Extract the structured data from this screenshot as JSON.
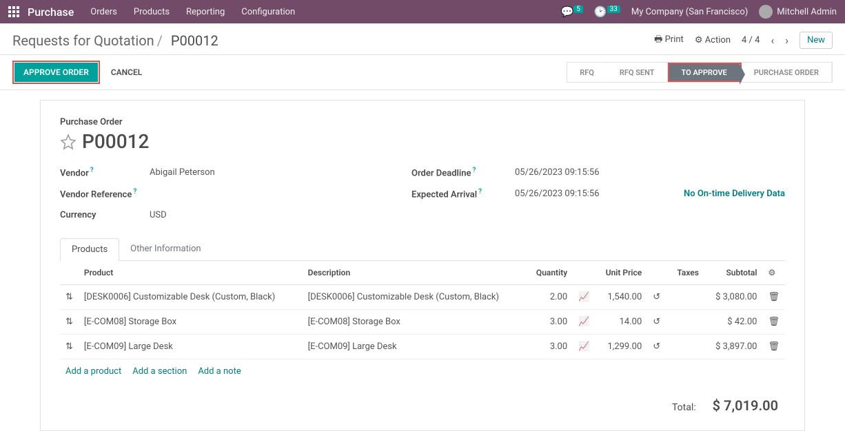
{
  "topnav": {
    "brand": "Purchase",
    "links": [
      "Orders",
      "Products",
      "Reporting",
      "Configuration"
    ],
    "chat_count": "5",
    "activity_count": "33",
    "company": "My Company (San Francisco)",
    "user": "Mitchell Admin"
  },
  "breadcrumb": {
    "root": "Requests for Quotation",
    "current": "P00012",
    "print": "Print",
    "action": "Action",
    "pager": "4 / 4",
    "new": "New"
  },
  "actions": {
    "approve": "APPROVE ORDER",
    "cancel": "CANCEL"
  },
  "status_steps": [
    "RFQ",
    "RFQ SENT",
    "TO APPROVE",
    "PURCHASE ORDER"
  ],
  "status_active_index": 2,
  "po": {
    "label": "Purchase Order",
    "name": "P00012",
    "fields": {
      "vendor_label": "Vendor",
      "vendor": "Abigail Peterson",
      "vendor_ref_label": "Vendor Reference",
      "vendor_ref": "",
      "currency_label": "Currency",
      "currency": "USD",
      "deadline_label": "Order Deadline",
      "deadline": "05/26/2023 09:15:56",
      "expected_label": "Expected Arrival",
      "expected": "05/26/2023 09:15:56",
      "no_delivery": "No On-time Delivery Data"
    }
  },
  "tabs": [
    "Products",
    "Other Information"
  ],
  "columns": {
    "product": "Product",
    "description": "Description",
    "quantity": "Quantity",
    "unit_price": "Unit Price",
    "taxes": "Taxes",
    "subtotal": "Subtotal"
  },
  "lines": [
    {
      "product": "[DESK0006] Customizable Desk (Custom, Black)",
      "description": "[DESK0006] Customizable Desk (Custom, Black)",
      "qty": "2.00",
      "price": "1,540.00",
      "taxes": "",
      "subtotal": "$ 3,080.00"
    },
    {
      "product": "[E-COM08] Storage Box",
      "description": "[E-COM08] Storage Box",
      "qty": "3.00",
      "price": "14.00",
      "taxes": "",
      "subtotal": "$ 42.00"
    },
    {
      "product": "[E-COM09] Large Desk",
      "description": "[E-COM09] Large Desk",
      "qty": "3.00",
      "price": "1,299.00",
      "taxes": "",
      "subtotal": "$ 3,897.00"
    }
  ],
  "add_links": {
    "product": "Add a product",
    "section": "Add a section",
    "note": "Add a note"
  },
  "totals": {
    "label": "Total:",
    "value": "$ 7,019.00"
  }
}
